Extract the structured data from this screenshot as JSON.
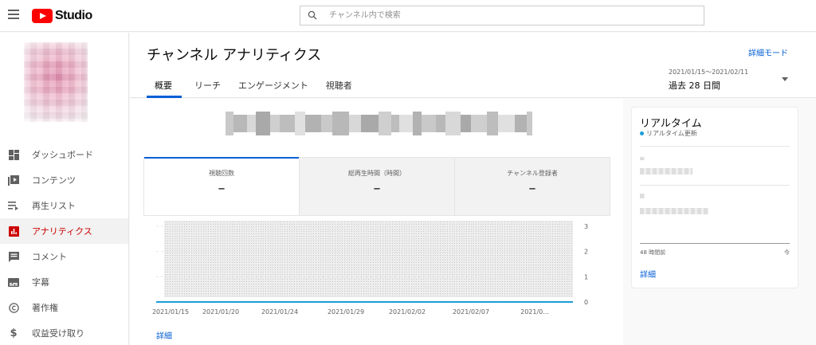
{
  "app": {
    "logo_text": "Studio",
    "brand_color": "#ff0000",
    "accent_color": "#065fd4"
  },
  "search": {
    "placeholder": "チャンネル内で検索",
    "value": ""
  },
  "sidebar": {
    "items": [
      {
        "label": "ダッシュボード",
        "icon": "dashboard-icon",
        "active": false
      },
      {
        "label": "コンテンツ",
        "icon": "video-library-icon",
        "active": false
      },
      {
        "label": "再生リスト",
        "icon": "playlist-icon",
        "active": false
      },
      {
        "label": "アナリティクス",
        "icon": "analytics-icon",
        "active": true
      },
      {
        "label": "コメント",
        "icon": "comment-icon",
        "active": false
      },
      {
        "label": "字幕",
        "icon": "subtitles-icon",
        "active": false
      },
      {
        "label": "著作権",
        "icon": "copyright-icon",
        "active": false
      },
      {
        "label": "収益受け取り",
        "icon": "dollar-icon",
        "active": false
      }
    ]
  },
  "header": {
    "title": "チャンネル アナリティクス",
    "advanced_mode": "詳細モード",
    "tabs": [
      {
        "label": "概要",
        "active": true
      },
      {
        "label": "リーチ",
        "active": false
      },
      {
        "label": "エンゲージメント",
        "active": false
      },
      {
        "label": "視聴者",
        "active": false
      }
    ],
    "date_range": "2021/01/15～2021/02/11",
    "period": "過去 28 日間"
  },
  "metrics": [
    {
      "label": "視聴回数",
      "value": "–",
      "active": true
    },
    {
      "label": "総再生時間（時間）",
      "value": "–",
      "active": false
    },
    {
      "label": "チャンネル登録者",
      "value": "–",
      "active": false
    }
  ],
  "chart_data": {
    "type": "line",
    "x": [
      "2021/01/15",
      "2021/01/20",
      "2021/01/24",
      "2021/01/29",
      "2021/02/02",
      "2021/02/07",
      "2021/0..."
    ],
    "series": [
      {
        "values": [
          0,
          0,
          0,
          0,
          0,
          0,
          0
        ]
      }
    ],
    "y_ticks": [
      "0",
      "1",
      "2",
      "3"
    ],
    "ylim": [
      0,
      3
    ],
    "grid": true,
    "line_color": "#1a9ed9"
  },
  "main": {
    "detail_link": "詳細"
  },
  "realtime": {
    "title": "リアルタイム",
    "subtitle": "リアルタイム更新",
    "from_label": "48 時間前",
    "to_label": "今",
    "detail_link": "詳細"
  }
}
